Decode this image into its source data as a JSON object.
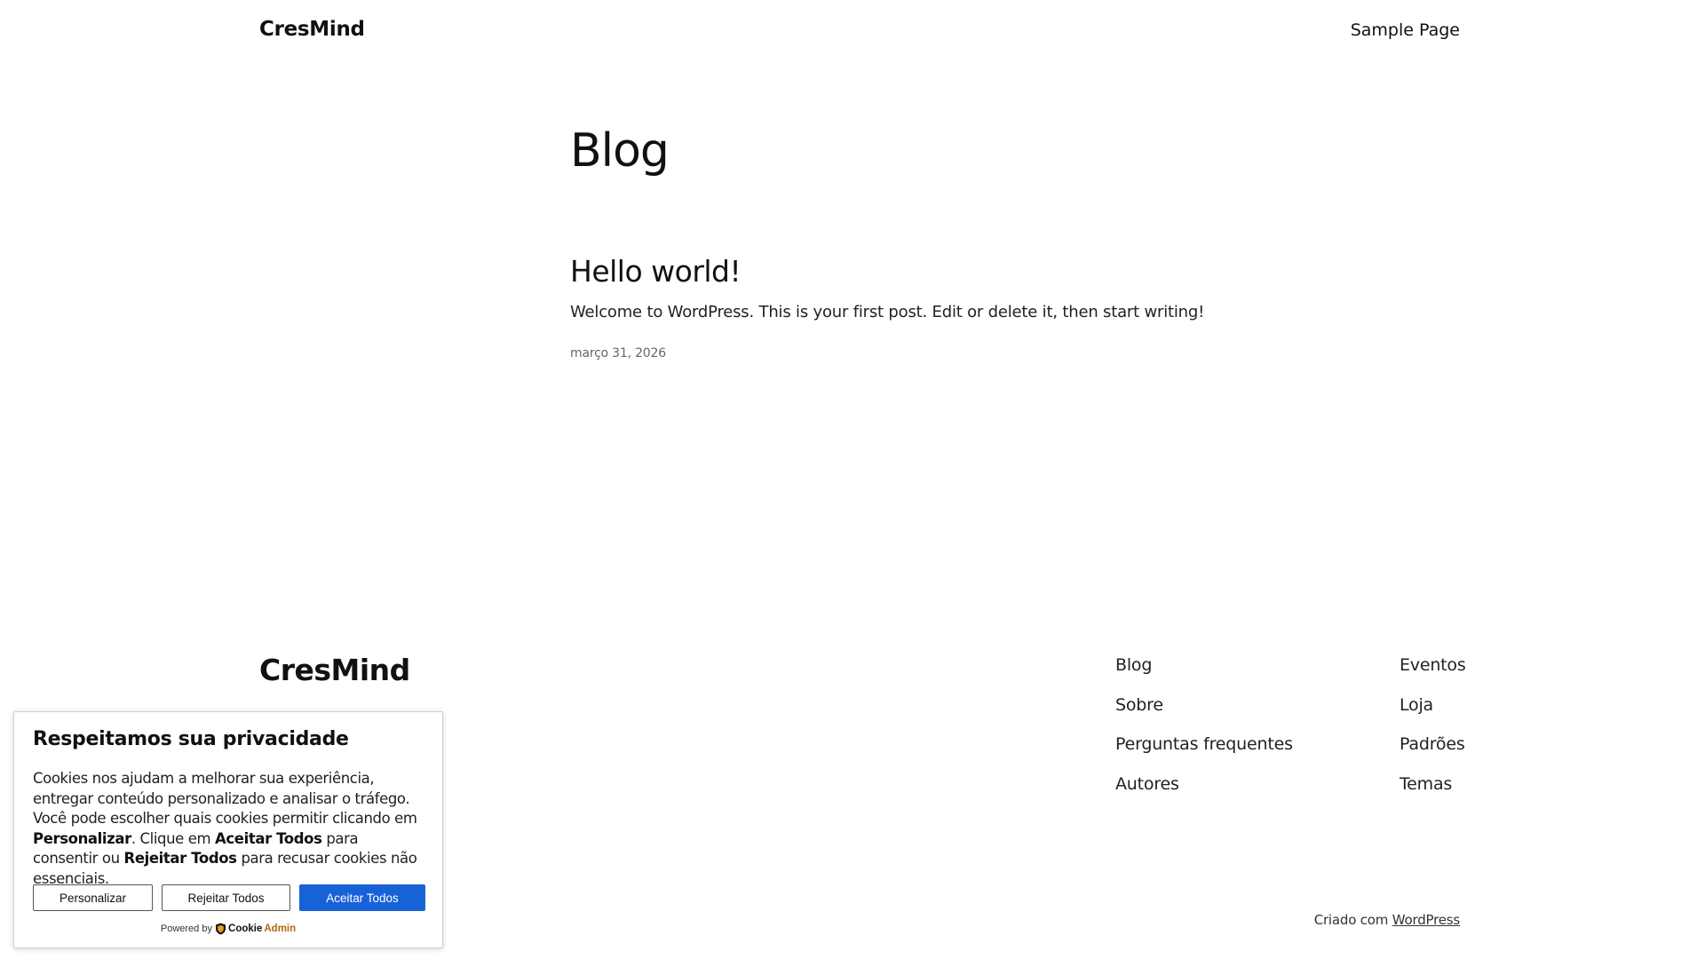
{
  "header": {
    "site_title": "CresMind",
    "nav": [
      "Sample Page"
    ]
  },
  "main": {
    "page_title": "Blog",
    "posts": [
      {
        "title": "Hello world!",
        "excerpt": "Welcome to WordPress. This is your first post. Edit or delete it, then start writing!",
        "date": "março 31, 2026"
      }
    ]
  },
  "footer": {
    "logo": "CresMind",
    "nav_col1": [
      "Blog",
      "Sobre",
      "Perguntas frequentes",
      "Autores"
    ],
    "nav_col2": [
      "Eventos",
      "Loja",
      "Padrões",
      "Temas"
    ],
    "credit_prefix": "Criado com ",
    "credit_link": "WordPress"
  },
  "cookie_banner": {
    "title": "Respeitamos sua privacidade",
    "text_1": "Cookies nos ajudam a melhorar sua experiência, entregar conteúdo personalizado e analisar o tráfego. Você pode escolher quais cookies permitir clicando em ",
    "text_bold_1": "Personalizar",
    "text_2": ". Clique em ",
    "text_bold_2": "Aceitar Todos",
    "text_3": " para consentir ou ",
    "text_bold_3": "Rejeitar Todos",
    "text_4": " para recusar cookies não essenciais.",
    "btn_customize": "Personalizar",
    "btn_reject": "Rejeitar Todos",
    "btn_accept": "Aceitar Todos",
    "powered_prefix": "Powered by",
    "brand_part1": "Cookie",
    "brand_part2": "Admin",
    "accept_color": "#1862d8",
    "brand_color": "#b36a10"
  }
}
